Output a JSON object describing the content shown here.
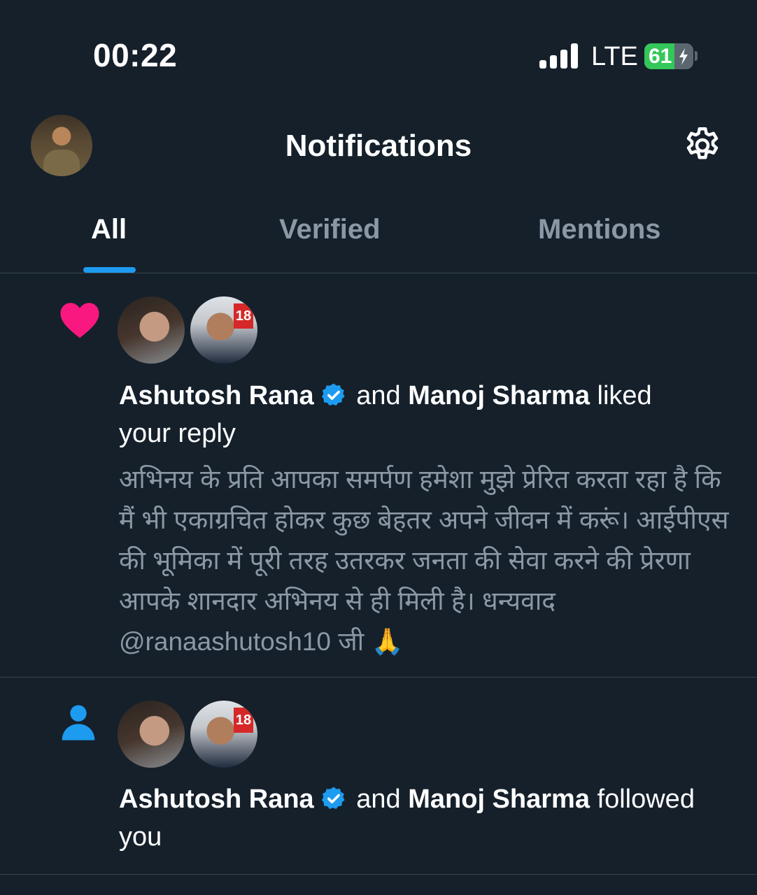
{
  "status_bar": {
    "time": "00:22",
    "network": "LTE",
    "battery": "61",
    "battery_level": 0.61
  },
  "header": {
    "title": "Notifications",
    "avatar_icon": "profile-avatar",
    "settings_icon": "gear-icon"
  },
  "tabs": [
    {
      "label": "All",
      "active": true
    },
    {
      "label": "Verified",
      "active": false
    },
    {
      "label": "Mentions",
      "active": false
    }
  ],
  "notifications": [
    {
      "type": "like",
      "icon": "heart-icon",
      "user1": "Ashutosh Rana",
      "connector": "and",
      "user2": "Manoj Sharma",
      "action_line1": "liked",
      "action_line2": "your reply",
      "reply_text": "अभिनय के प्रति आपका समर्पण हमेशा मुझे प्रेरित करता रहा है कि मैं भी एकाग्रचित होकर कुछ बेहतर अपने जीवन में करूं। आईपीएस की भूमिका में पूरी तरह उतरकर जनता की सेवा करने की  प्रेरणा आपके शानदार अभिनय से ही मिली है। धन्यवाद @ranaashutosh10 जी 🙏"
    },
    {
      "type": "follow",
      "icon": "person-icon",
      "user1": "Ashutosh Rana",
      "connector": "and",
      "user2": "Manoj Sharma",
      "action_line1": "followed",
      "action_line2": "you"
    }
  ],
  "colors": {
    "background": "#15202b",
    "accent": "#1d9bf0",
    "like": "#f91880",
    "muted": "#8b98a5",
    "divider": "#38444d"
  }
}
